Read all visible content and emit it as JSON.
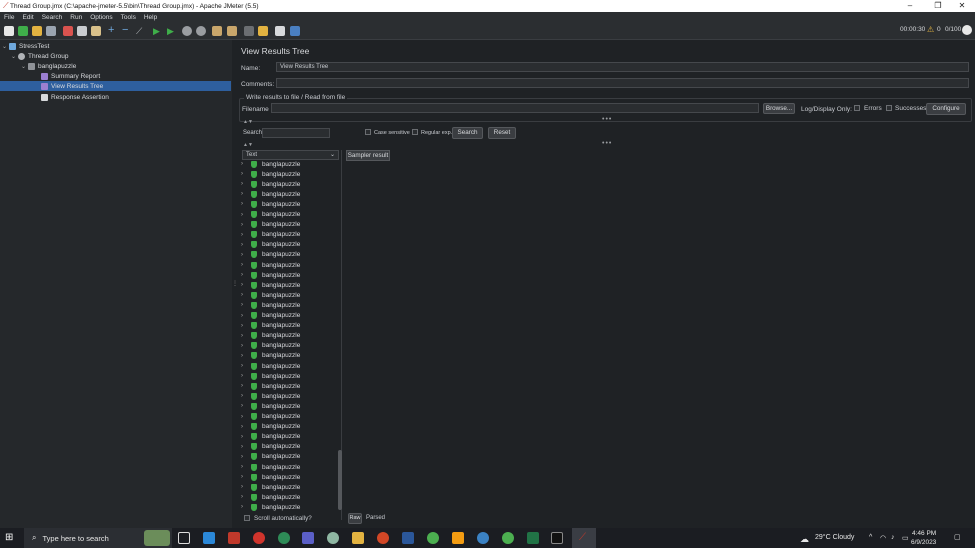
{
  "window": {
    "title": "Thread Group.jmx (C:\\apache-jmeter-5.5\\bin\\Thread Group.jmx) - Apache JMeter (5.5)"
  },
  "menu": [
    "File",
    "Edit",
    "Search",
    "Run",
    "Options",
    "Tools",
    "Help"
  ],
  "toolbar": {
    "timer": "00:00:30",
    "warning_count": "0",
    "threads": "0/100"
  },
  "tree": {
    "nodes": [
      {
        "label": "StressTest",
        "icon": "testplan-icon"
      },
      {
        "label": "Thread Group",
        "icon": "gear-icon"
      },
      {
        "label": "banglapuzzle",
        "icon": "sampler-icon"
      },
      {
        "label": "Summary Report",
        "icon": "report-icon"
      },
      {
        "label": "View Results Tree",
        "icon": "report-icon"
      },
      {
        "label": "Response Assertion",
        "icon": "assertion-icon"
      }
    ]
  },
  "panel": {
    "title": "View Results Tree",
    "name_label": "Name:",
    "name_value": "View Results Tree",
    "comments_label": "Comments:",
    "write_results_label": "Write results to file / Read from file",
    "filename_label": "Filename",
    "browse_label": "Browse...",
    "log_display_label": "Log/Display Only:",
    "errors_label": "Errors",
    "successes_label": "Successes",
    "configure_label": "Configure",
    "search_label": "Search:",
    "case_sensitive_label": "Case sensitive",
    "regular_exp_label": "Regular exp.",
    "search_button": "Search",
    "reset_button": "Reset",
    "renderer_value": "Text",
    "sampler_tab": "Sampler result",
    "scroll_auto_label": "Scroll automatically?",
    "raw_tab": "Raw",
    "parsed_tab": "Parsed",
    "result_item": "banglapuzzle",
    "result_count": 35
  },
  "taskbar": {
    "search_placeholder": "Type here to search",
    "weather": "29°C  Cloudy",
    "time": "4:46 PM",
    "date": "6/9/2023"
  },
  "colors": {
    "selection": "#2e5f9e",
    "success": "#3fae4a"
  }
}
